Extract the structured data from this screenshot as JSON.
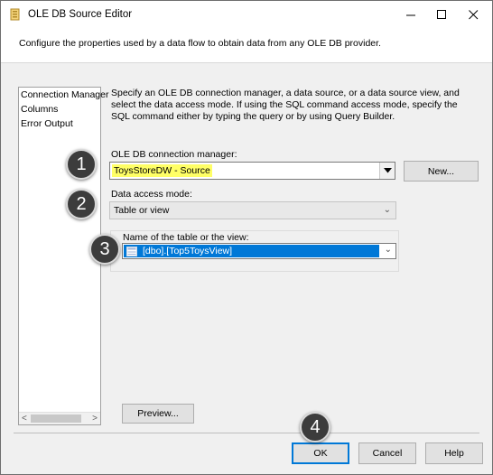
{
  "window": {
    "title": "OLE DB Source Editor",
    "minimize_glyph": "—",
    "maximize_glyph": "☐",
    "close_glyph": "✕"
  },
  "header": {
    "description": "Configure the properties used by a data flow to obtain data from any OLE DB provider."
  },
  "nav": {
    "items": [
      {
        "label": "Connection Manager"
      },
      {
        "label": "Columns"
      },
      {
        "label": "Error Output"
      }
    ]
  },
  "content": {
    "description": "Specify an OLE DB connection manager, a data source, or a data source view, and select the data access mode. If using the SQL command access mode, specify the SQL command either by typing the query or by using Query Builder.",
    "connection_manager_label": "OLE DB connection manager:",
    "connection_manager_value": "ToysStoreDW - Source",
    "new_button_label": "New...",
    "data_access_mode_label": "Data access mode:",
    "data_access_mode_value": "Table or view",
    "table_name_label": "Name of the table or the view:",
    "table_name_value": "[dbo].[Top5ToysView]",
    "preview_button_label": "Preview..."
  },
  "footer": {
    "ok_label": "OK",
    "cancel_label": "Cancel",
    "help_label": "Help"
  },
  "markers": [
    "1",
    "2",
    "3",
    "4"
  ],
  "colors": {
    "highlight": "#ffff66",
    "selection": "#0078d7",
    "marker_fill": "#3c3c3c"
  }
}
